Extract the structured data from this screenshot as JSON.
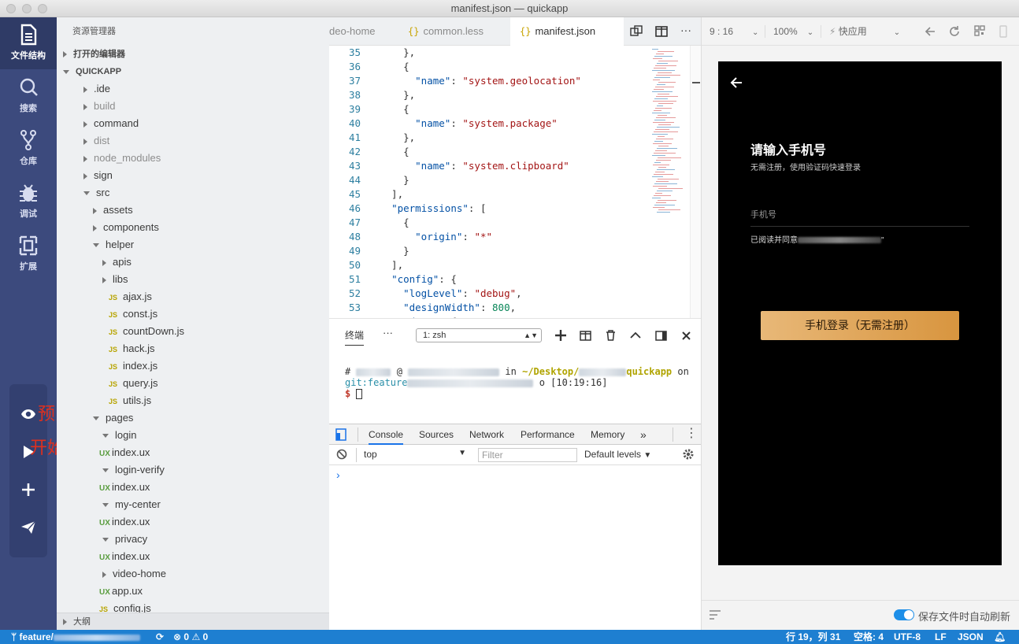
{
  "window": {
    "title": "manifest.json — quickapp"
  },
  "activity": {
    "items": [
      {
        "label": "文件结构",
        "icon": "file-icon"
      },
      {
        "label": "搜索",
        "icon": "search-icon"
      },
      {
        "label": "仓库",
        "icon": "source-control-icon"
      },
      {
        "label": "调试",
        "icon": "bug-icon"
      },
      {
        "label": "扩展",
        "icon": "extensions-icon"
      }
    ],
    "preview_annotation": "预览",
    "debug_annotation": "开始调试"
  },
  "explorer": {
    "title": "资源管理器",
    "open_editors": "打开的编辑器",
    "project": "QUICKAPP",
    "outline": "大纲",
    "tree": [
      {
        "label": ".ide",
        "depth": 0,
        "type": "folder",
        "open": false,
        "dim": false
      },
      {
        "label": "build",
        "depth": 0,
        "type": "folder",
        "open": false,
        "dim": true
      },
      {
        "label": "command",
        "depth": 0,
        "type": "folder",
        "open": false,
        "dim": false
      },
      {
        "label": "dist",
        "depth": 0,
        "type": "folder",
        "open": false,
        "dim": true
      },
      {
        "label": "node_modules",
        "depth": 0,
        "type": "folder",
        "open": false,
        "dim": true
      },
      {
        "label": "sign",
        "depth": 0,
        "type": "folder",
        "open": false,
        "dim": false
      },
      {
        "label": "src",
        "depth": 0,
        "type": "folder",
        "open": true,
        "dim": false
      },
      {
        "label": "assets",
        "depth": 1,
        "type": "folder",
        "open": false,
        "dim": false
      },
      {
        "label": "components",
        "depth": 1,
        "type": "folder",
        "open": false,
        "dim": false
      },
      {
        "label": "helper",
        "depth": 1,
        "type": "folder",
        "open": true,
        "dim": false
      },
      {
        "label": "apis",
        "depth": 2,
        "type": "folder",
        "open": false,
        "dim": false
      },
      {
        "label": "libs",
        "depth": 2,
        "type": "folder",
        "open": false,
        "dim": false
      },
      {
        "label": "ajax.js",
        "depth": 2,
        "type": "js",
        "dim": false
      },
      {
        "label": "const.js",
        "depth": 2,
        "type": "js",
        "dim": false
      },
      {
        "label": "countDown.js",
        "depth": 2,
        "type": "js",
        "dim": false
      },
      {
        "label": "hack.js",
        "depth": 2,
        "type": "js",
        "dim": false
      },
      {
        "label": "index.js",
        "depth": 2,
        "type": "js",
        "dim": false
      },
      {
        "label": "query.js",
        "depth": 2,
        "type": "js",
        "dim": false
      },
      {
        "label": "utils.js",
        "depth": 2,
        "type": "js",
        "dim": false
      },
      {
        "label": "pages",
        "depth": 1,
        "type": "folder",
        "open": true,
        "dim": false
      },
      {
        "label": "login",
        "depth": 2,
        "type": "folder",
        "open": true,
        "dim": false
      },
      {
        "label": "index.ux",
        "depth": 3,
        "type": "ux",
        "dim": false
      },
      {
        "label": "login-verify",
        "depth": 2,
        "type": "folder",
        "open": true,
        "dim": false
      },
      {
        "label": "index.ux",
        "depth": 3,
        "type": "ux",
        "dim": false
      },
      {
        "label": "my-center",
        "depth": 2,
        "type": "folder",
        "open": true,
        "dim": false
      },
      {
        "label": "index.ux",
        "depth": 3,
        "type": "ux",
        "dim": false
      },
      {
        "label": "privacy",
        "depth": 2,
        "type": "folder",
        "open": true,
        "dim": false
      },
      {
        "label": "index.ux",
        "depth": 3,
        "type": "ux",
        "dim": false
      },
      {
        "label": "video-home",
        "depth": 2,
        "type": "folder",
        "open": false,
        "dim": false
      },
      {
        "label": "app.ux",
        "depth": 1,
        "type": "ux",
        "dim": false
      },
      {
        "label": "config.js",
        "depth": 1,
        "type": "js",
        "dim": false
      }
    ]
  },
  "editor": {
    "tabs": [
      {
        "label": "deo-home",
        "active": false
      },
      {
        "label": "common.less",
        "active": false
      },
      {
        "label": "manifest.json",
        "active": true
      }
    ],
    "code": [
      {
        "n": "35",
        "t": "    },"
      },
      {
        "n": "36",
        "t": "    {"
      },
      {
        "n": "37",
        "t": "      \"name\": \"system.geolocation\""
      },
      {
        "n": "38",
        "t": "    },"
      },
      {
        "n": "39",
        "t": "    {"
      },
      {
        "n": "40",
        "t": "      \"name\": \"system.package\""
      },
      {
        "n": "41",
        "t": "    },"
      },
      {
        "n": "42",
        "t": "    {"
      },
      {
        "n": "43",
        "t": "      \"name\": \"system.clipboard\""
      },
      {
        "n": "44",
        "t": "    }"
      },
      {
        "n": "45",
        "t": "  ],"
      },
      {
        "n": "46",
        "t": "  \"permissions\": ["
      },
      {
        "n": "47",
        "t": "    {"
      },
      {
        "n": "48",
        "t": "      \"origin\": \"*\""
      },
      {
        "n": "49",
        "t": "    }"
      },
      {
        "n": "50",
        "t": "  ],"
      },
      {
        "n": "51",
        "t": "  \"config\": {"
      },
      {
        "n": "52",
        "t": "    \"logLevel\": \"debug\","
      },
      {
        "n": "53",
        "t": "    \"designWidth\": 800,"
      },
      {
        "n": "54",
        "t": "    \"data\": {"
      }
    ]
  },
  "terminal": {
    "tab_label": "终端",
    "more": "···",
    "shell_select": "1: zsh",
    "line1_hash": "#",
    "line1_at": "@",
    "line1_in": "in",
    "line1_path": "~/Desktop/",
    "line1_repo": "quickapp",
    "line1_on": "on",
    "line2_git": "git:feature",
    "line2_time": "o [10:19:16]",
    "line3_prompt": "$"
  },
  "devtools": {
    "tabs": [
      "Console",
      "Sources",
      "Network",
      "Performance",
      "Memory"
    ],
    "more": "»",
    "context": "top",
    "filter_placeholder": "Filter",
    "levels": "Default levels",
    "prompt": "›"
  },
  "preview": {
    "ratio": "9 : 16",
    "zoom": "100%",
    "platform": "快应用",
    "phone": {
      "heading": "请输入手机号",
      "subheading": "无需注册，使用验证码快速登录",
      "phone_placeholder": "手机号",
      "agreement_prefix": "已阅读并同意",
      "agreement_suffix": "\"",
      "login_button": "手机登录（无需注册）"
    },
    "auto_refresh_label": "保存文件时自动刷新",
    "auto_refresh": true
  },
  "statusbar": {
    "branch": "feature/",
    "errors": "0",
    "warnings": "0",
    "position": "行 19，列 31",
    "spaces": "空格: 4",
    "encoding": "UTF-8",
    "eol": "LF",
    "language": "JSON"
  },
  "colors": {
    "activity": "#3c4a7d",
    "status": "#1e7fd1",
    "button": "#e0a55a"
  }
}
